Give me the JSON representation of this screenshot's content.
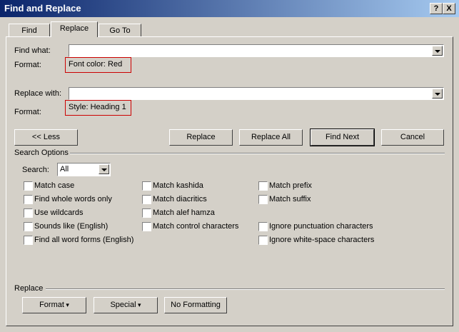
{
  "window": {
    "title": "Find and Replace",
    "help": "?",
    "close": "X"
  },
  "tabs": [
    {
      "label": "Find",
      "active": false
    },
    {
      "label": "Replace",
      "active": true
    },
    {
      "label": "Go To",
      "active": false
    }
  ],
  "find": {
    "label": "Find what:",
    "value": "",
    "format_label": "Format:",
    "format_value": "Font color: Red"
  },
  "replace": {
    "label": "Replace with:",
    "value": "",
    "format_label": "Format:",
    "format_value": "Style: Heading 1"
  },
  "buttons": {
    "less": "<< Less",
    "replace": "Replace",
    "replace_all": "Replace All",
    "find_next": "Find Next",
    "cancel": "Cancel"
  },
  "search_options": {
    "heading": "Search Options",
    "search_label": "Search:",
    "search_value": "All",
    "col1": [
      "Match case",
      "Find whole words only",
      "Use wildcards",
      "Sounds like (English)",
      "Find all word forms (English)"
    ],
    "col2": [
      "Match kashida",
      "Match diacritics",
      "Match alef hamza",
      "Match control characters"
    ],
    "col3a": [
      "Match prefix",
      "Match suffix"
    ],
    "col3b": [
      "Ignore punctuation characters",
      "Ignore white-space characters"
    ]
  },
  "replace_section": {
    "heading": "Replace",
    "format": "Format",
    "special": "Special",
    "no_formatting": "No Formatting"
  },
  "colors": {
    "title_start": "#0a246a",
    "title_end": "#a6caf0",
    "face": "#d4d0c8",
    "format_border": "#cc0000"
  }
}
